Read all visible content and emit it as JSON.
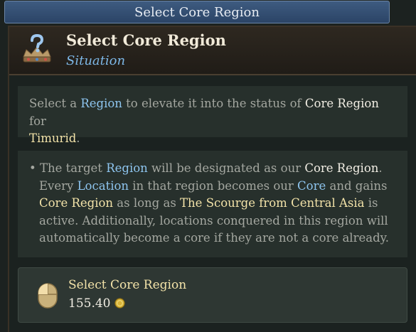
{
  "topbar": {
    "title": "Select Core Region"
  },
  "tooltip": {
    "title": "Select Core Region",
    "subtitle": "Situation",
    "intro": {
      "t1": "Select a ",
      "t2": "Region",
      "t3": " to elevate it into the status of ",
      "t4": "Core Region",
      "t5": " for",
      "t6": "Timurid",
      "t7": "."
    },
    "details": {
      "bullet": "•",
      "l1a": " The target ",
      "l1b": "Region",
      "l1c": " will be designated as our ",
      "l1d": "Core Region",
      "l1e": ".",
      "l2a": "Every ",
      "l2b": "Location",
      "l2c": " in that region becomes our ",
      "l2d": "Core",
      "l2e": " and gains",
      "l3a": "Core Region",
      "l3b": " as long as ",
      "l3c": "The Scourge from Central Asia",
      "l3d": " is",
      "l4": "active. Additionally, locations conquered in this region will",
      "l5": "automatically become a core if they are not a core already."
    },
    "action": {
      "label": "Select Core Region",
      "cost": "155.40",
      "mouse_icon": "left-click-icon",
      "currency_icon": "gold-coin-icon"
    }
  }
}
